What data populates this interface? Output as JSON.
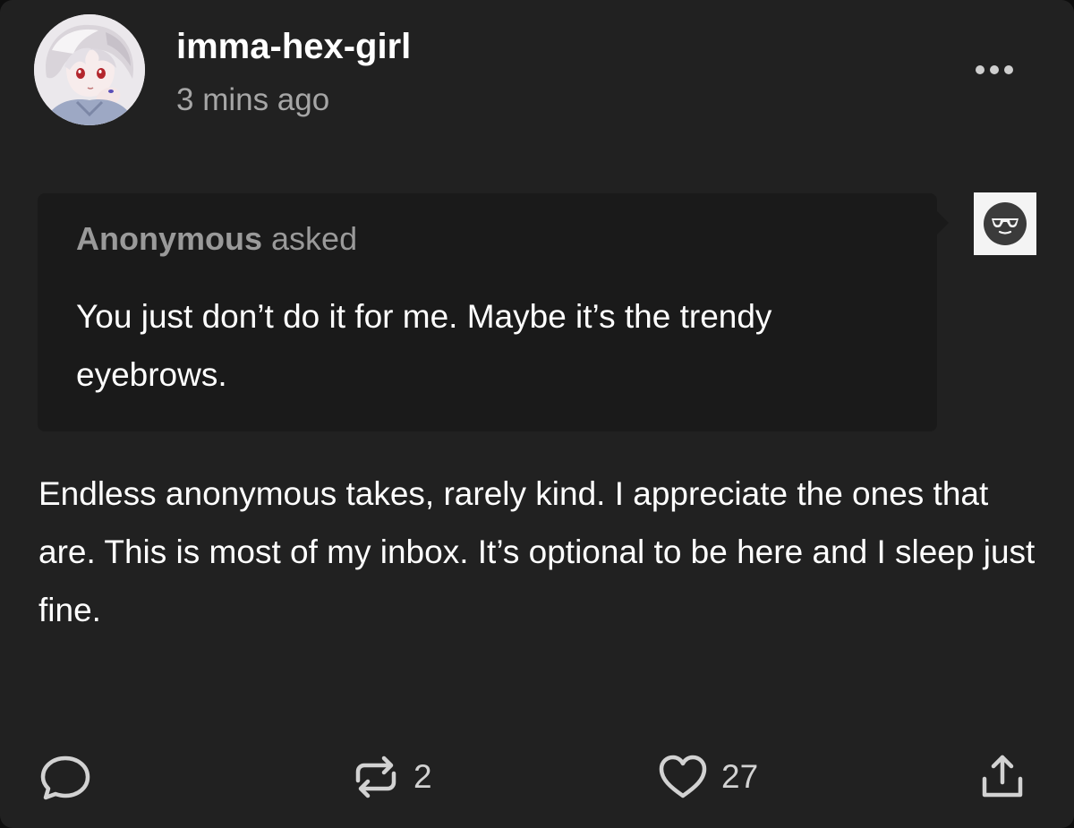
{
  "post": {
    "author": {
      "username": "imma-hex-girl",
      "time_ago": "3 mins ago",
      "avatar_icon": "avatar-anime-girl"
    },
    "menu_icon": "more-dots-icon",
    "ask": {
      "asker": "Anonymous",
      "asked_label": "asked",
      "question": "You just don’t do it for me. Maybe it’s the trendy eyebrows.",
      "asker_avatar_icon": "anonymous-sunglasses-icon"
    },
    "answer": "Endless anonymous takes, rarely kind. I appreciate the ones that are. This is most of my inbox. It’s optional to be here and I sleep just fine.",
    "actions": {
      "reply_icon": "reply-icon",
      "reblog_icon": "reblog-icon",
      "reblog_count": "2",
      "like_icon": "heart-icon",
      "like_count": "27",
      "share_icon": "share-icon"
    }
  },
  "colors": {
    "background": "#212121",
    "ask_background": "#1a1a1a",
    "text": "#ffffff",
    "muted_text": "#a6a6a6"
  }
}
